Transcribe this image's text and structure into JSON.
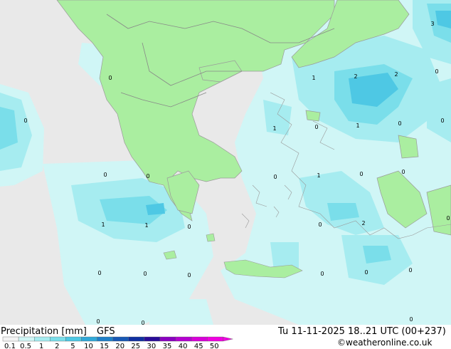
{
  "title": "Precipitation [mm]",
  "model": "GFS",
  "valid_time": "Tu 11-11-2025 18..21 UTC (00+237)",
  "credit": "©weatheronline.co.uk",
  "legend": {
    "ticks": [
      "0.1",
      "0.5",
      "1",
      "2",
      "5",
      "10",
      "15",
      "20",
      "25",
      "30",
      "35",
      "40",
      "45",
      "50"
    ],
    "colors": [
      "#f4f4f4",
      "#d0f6f6",
      "#a6ecf0",
      "#7adeea",
      "#4ec8e4",
      "#31a8d8",
      "#2080c8",
      "#1858b4",
      "#1030a0",
      "#2a0c98",
      "#8a00c0",
      "#b400d0",
      "#d800d8",
      "#f000e0"
    ]
  },
  "map_labels": [
    {
      "value": "3"
    },
    {
      "value": "0"
    },
    {
      "value": "1"
    },
    {
      "value": "2"
    },
    {
      "value": "2"
    },
    {
      "value": "0"
    },
    {
      "value": "0"
    },
    {
      "value": "0"
    },
    {
      "value": "1"
    },
    {
      "value": "0"
    },
    {
      "value": "1"
    },
    {
      "value": "0"
    },
    {
      "value": "0"
    },
    {
      "value": "0"
    },
    {
      "value": "0"
    },
    {
      "value": "1"
    },
    {
      "value": "0"
    },
    {
      "value": "0"
    },
    {
      "value": "0"
    },
    {
      "value": "1"
    },
    {
      "value": "1"
    },
    {
      "value": "0"
    },
    {
      "value": "0"
    },
    {
      "value": "2"
    },
    {
      "value": "0"
    },
    {
      "value": "0"
    },
    {
      "value": "0"
    },
    {
      "value": "0"
    },
    {
      "value": "0"
    },
    {
      "value": "0"
    },
    {
      "value": "0"
    },
    {
      "value": "0"
    },
    {
      "value": "0"
    }
  ]
}
